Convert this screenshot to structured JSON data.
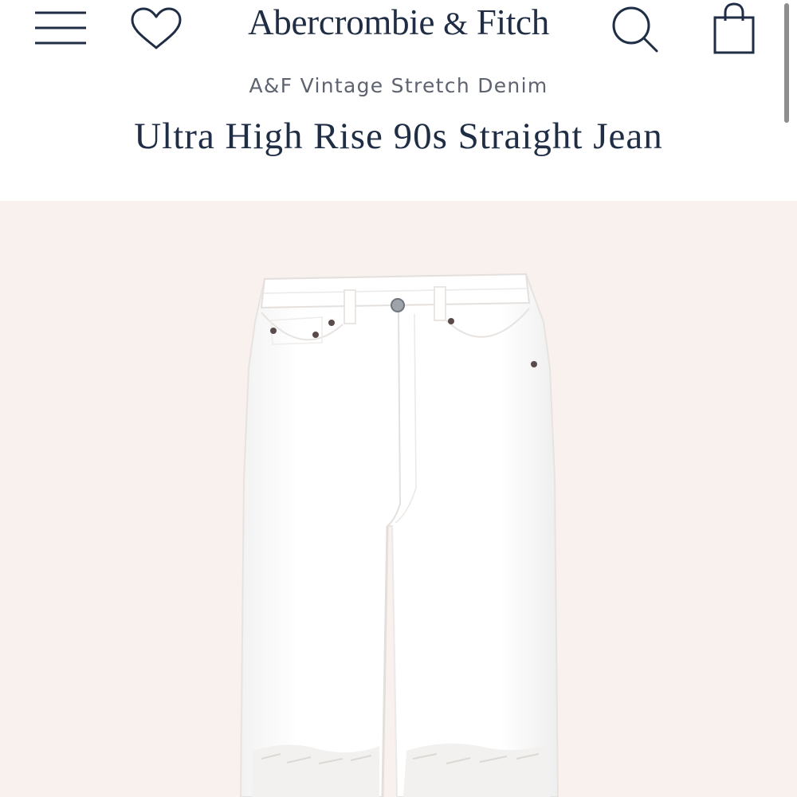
{
  "header": {
    "brand_main": "Abercrombie",
    "brand_amp": "&",
    "brand_tail": "Fitch",
    "menu_icon": "hamburger-menu-icon",
    "wishlist_icon": "heart-icon",
    "search_icon": "search-icon",
    "bag_icon": "shopping-bag-icon"
  },
  "product": {
    "collection": "A&F Vintage Stretch Denim",
    "title": "Ultra High Rise 90s Straight Jean",
    "image_name": "white-straight-jeans-image"
  },
  "colors": {
    "text_dark": "#1f2d45",
    "text_muted": "#5e6370",
    "image_background": "#f8f1ee",
    "denim_white": "#ffffff"
  }
}
